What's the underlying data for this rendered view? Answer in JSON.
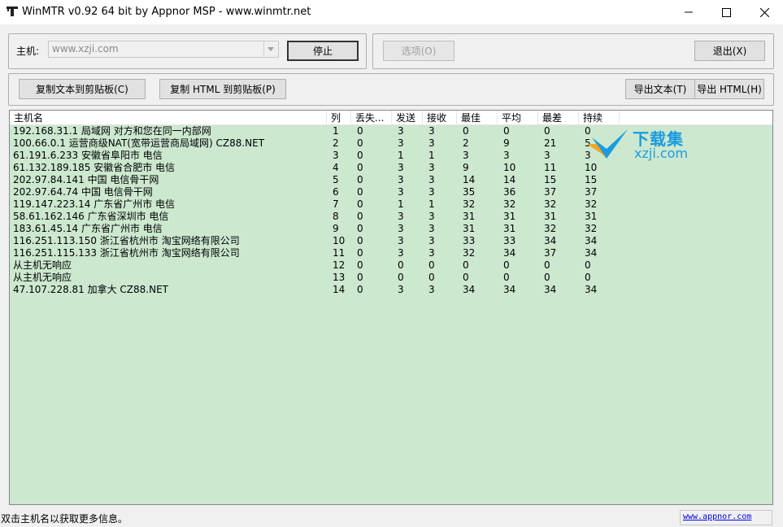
{
  "window": {
    "title": "WinMTR v0.92 64 bit by Appnor MSP - www.winmtr.net",
    "icon": "winmtr-app-icon",
    "controls": [
      "minimize-icon",
      "maximize-icon",
      "close-icon"
    ]
  },
  "host": {
    "label": "主机:",
    "value": "www.xzji.com",
    "stop_label": "停止"
  },
  "options_label": "选项(O)",
  "exit_label": "退出(X)",
  "copy_text_label": "复制文本到剪贴板(C)",
  "copy_html_label": "复制 HTML 到剪贴板(P)",
  "export_text_label": "导出文本(T)",
  "export_html_label": "导出 HTML(H)",
  "table": {
    "headers": [
      "主机名",
      "列",
      "丢失...",
      "发送",
      "接收",
      "最佳",
      "平均",
      "最差",
      "持续"
    ],
    "rows": [
      [
        "192.168.31.1 局域网 对方和您在同一内部网",
        "1",
        "0",
        "3",
        "3",
        "0",
        "0",
        "0",
        "0"
      ],
      [
        "100.66.0.1 运营商级NAT(宽带运营商局域网)  CZ88.NET",
        "2",
        "0",
        "3",
        "3",
        "2",
        "9",
        "21",
        "5"
      ],
      [
        "61.191.6.233 安徽省阜阳市 电信",
        "3",
        "0",
        "1",
        "1",
        "3",
        "3",
        "3",
        "3"
      ],
      [
        "61.132.189.185 安徽省合肥市 电信",
        "4",
        "0",
        "3",
        "3",
        "9",
        "10",
        "11",
        "10"
      ],
      [
        "202.97.84.141 中国 电信骨干网",
        "5",
        "0",
        "3",
        "3",
        "14",
        "14",
        "15",
        "15"
      ],
      [
        "202.97.64.74 中国 电信骨干网",
        "6",
        "0",
        "3",
        "3",
        "35",
        "36",
        "37",
        "37"
      ],
      [
        "119.147.223.14 广东省广州市 电信",
        "7",
        "0",
        "1",
        "1",
        "32",
        "32",
        "32",
        "32"
      ],
      [
        "58.61.162.146 广东省深圳市 电信",
        "8",
        "0",
        "3",
        "3",
        "31",
        "31",
        "31",
        "31"
      ],
      [
        "183.61.45.14 广东省广州市 电信",
        "9",
        "0",
        "3",
        "3",
        "31",
        "31",
        "32",
        "32"
      ],
      [
        "116.251.113.150 浙江省杭州市 淘宝网络有限公司",
        "10",
        "0",
        "3",
        "3",
        "33",
        "33",
        "34",
        "34"
      ],
      [
        "116.251.115.133 浙江省杭州市 淘宝网络有限公司",
        "11",
        "0",
        "3",
        "3",
        "32",
        "34",
        "37",
        "34"
      ],
      [
        "从主机无响应",
        "12",
        "0",
        "0",
        "0",
        "0",
        "0",
        "0",
        "0"
      ],
      [
        "从主机无响应",
        "13",
        "0",
        "0",
        "0",
        "0",
        "0",
        "0",
        "0"
      ],
      [
        "47.107.228.81 加拿大  CZ88.NET",
        "14",
        "0",
        "3",
        "3",
        "34",
        "34",
        "34",
        "34"
      ]
    ]
  },
  "watermark": {
    "line1": "下载集",
    "line2": "xzji.com"
  },
  "status": {
    "text": "双击主机名以获取更多信息。",
    "link": "www.appnor.com"
  },
  "colors": {
    "list_background": "#cce8cf",
    "watermark_blue": "#1a9be0",
    "link": "#0000ee"
  }
}
